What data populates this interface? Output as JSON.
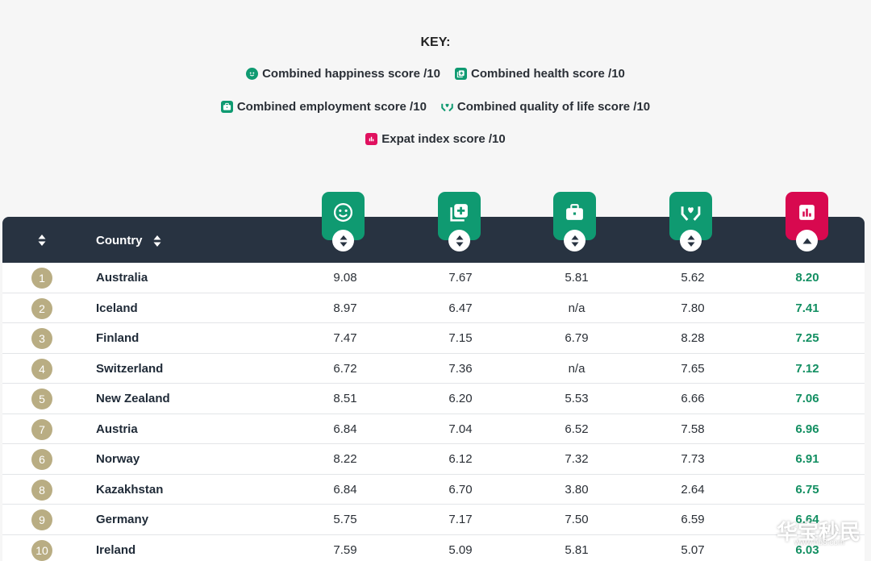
{
  "key": {
    "title": "KEY:",
    "items": [
      {
        "label": "Combined happiness score /10",
        "icon": "smiley-icon"
      },
      {
        "label": "Combined health score /10",
        "icon": "medical-cross-icon"
      },
      {
        "label": "Combined employment score /10",
        "icon": "briefcase-icon"
      },
      {
        "label": "Combined quality of life score /10",
        "icon": "heart-hands-icon"
      },
      {
        "label": "Expat index score /10",
        "icon": "bar-chart-icon"
      }
    ]
  },
  "colors": {
    "green": "#0f9a71",
    "pink": "#d8094f",
    "header": "#283341",
    "rank": "#b9ad83",
    "expat_text": "#138f62"
  },
  "table": {
    "header": {
      "country": "Country"
    },
    "rows": [
      {
        "rank": "1",
        "country": "Australia",
        "happiness": "9.08",
        "health": "7.67",
        "employment": "5.81",
        "quality": "5.62",
        "expat": "8.20"
      },
      {
        "rank": "2",
        "country": "Iceland",
        "happiness": "8.97",
        "health": "6.47",
        "employment": "n/a",
        "quality": "7.80",
        "expat": "7.41"
      },
      {
        "rank": "3",
        "country": "Finland",
        "happiness": "7.47",
        "health": "7.15",
        "employment": "6.79",
        "quality": "8.28",
        "expat": "7.25"
      },
      {
        "rank": "4",
        "country": "Switzerland",
        "happiness": "6.72",
        "health": "7.36",
        "employment": "n/a",
        "quality": "7.65",
        "expat": "7.12"
      },
      {
        "rank": "5",
        "country": "New Zealand",
        "happiness": "8.51",
        "health": "6.20",
        "employment": "5.53",
        "quality": "6.66",
        "expat": "7.06"
      },
      {
        "rank": "7",
        "country": "Austria",
        "happiness": "6.84",
        "health": "7.04",
        "employment": "6.52",
        "quality": "7.58",
        "expat": "6.96"
      },
      {
        "rank": "6",
        "country": "Norway",
        "happiness": "8.22",
        "health": "6.12",
        "employment": "7.32",
        "quality": "7.73",
        "expat": "6.91"
      },
      {
        "rank": "8",
        "country": "Kazakhstan",
        "happiness": "6.84",
        "health": "6.70",
        "employment": "3.80",
        "quality": "2.64",
        "expat": "6.75"
      },
      {
        "rank": "9",
        "country": "Germany",
        "happiness": "5.75",
        "health": "7.17",
        "employment": "7.50",
        "quality": "6.59",
        "expat": "6.64"
      },
      {
        "rank": "10",
        "country": "Ireland",
        "happiness": "7.59",
        "health": "5.09",
        "employment": "5.81",
        "quality": "5.07",
        "expat": "6.03"
      }
    ]
  },
  "watermark": {
    "main": "华宝秒民",
    "sub": "www.hb8.com"
  }
}
